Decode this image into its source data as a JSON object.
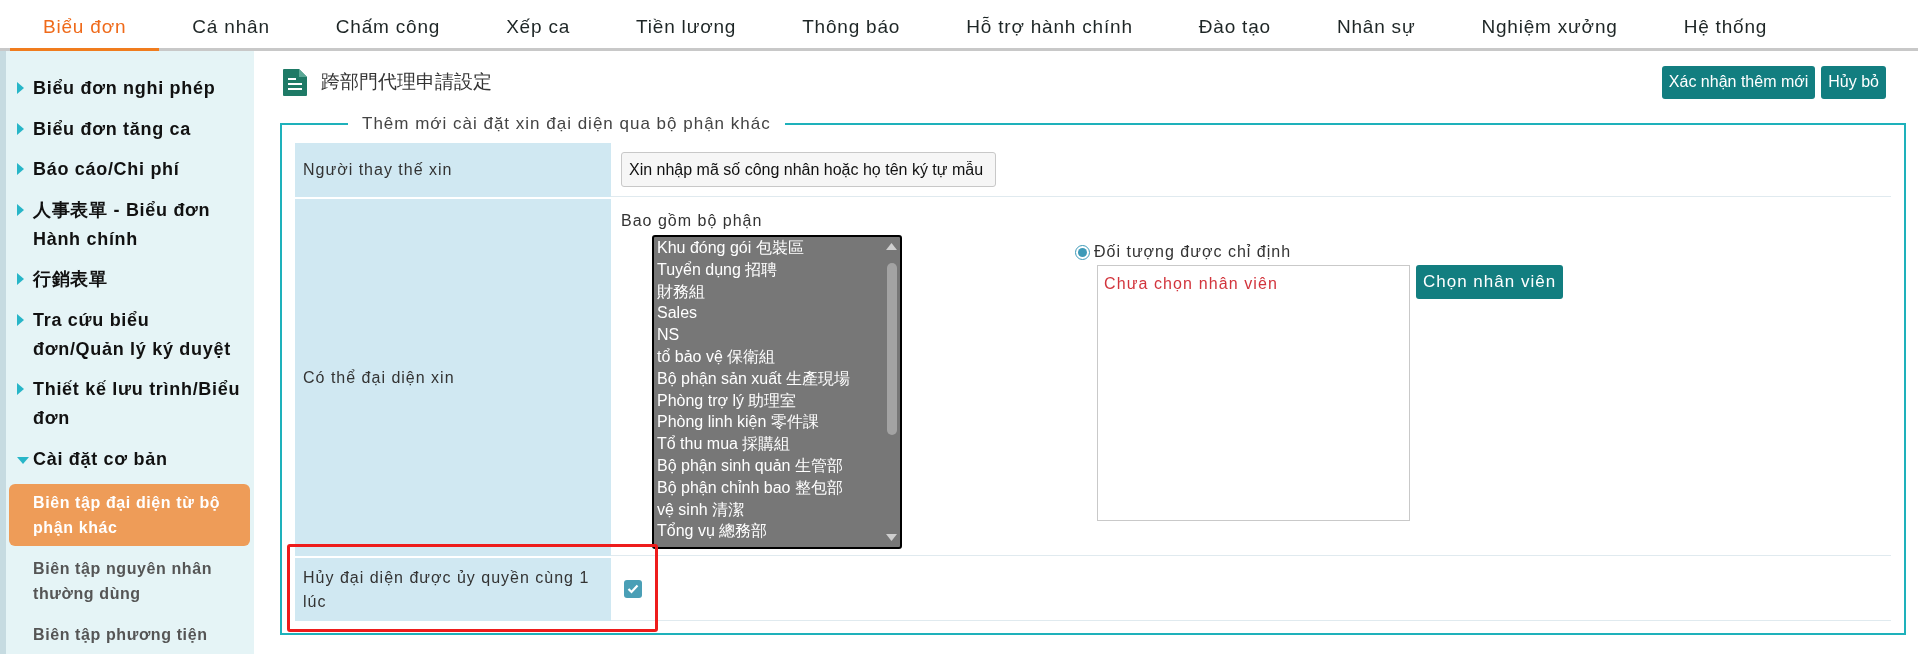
{
  "top_nav": {
    "tabs": [
      {
        "label": "Biểu đơn",
        "selected": true
      },
      {
        "label": "Cá nhân",
        "selected": false
      },
      {
        "label": "Chấm công",
        "selected": false
      },
      {
        "label": "Xếp ca",
        "selected": false
      },
      {
        "label": "Tiền lương",
        "selected": false
      },
      {
        "label": "Thông báo",
        "selected": false
      },
      {
        "label": "Hỗ trợ hành chính",
        "selected": false
      },
      {
        "label": "Đào tạo",
        "selected": false
      },
      {
        "label": "Nhân sự",
        "selected": false
      },
      {
        "label": "Nghiệm xưởng",
        "selected": false
      },
      {
        "label": "Hệ thống",
        "selected": false
      }
    ]
  },
  "sidebar": {
    "items": [
      {
        "label": "Biểu đơn nghi phép",
        "expanded": false
      },
      {
        "label": "Biểu đơn tăng ca",
        "expanded": false
      },
      {
        "label": "Báo cáo/Chi phí",
        "expanded": false
      },
      {
        "label": "人事表單 - Biểu đơn Hành chính",
        "expanded": false
      },
      {
        "label": "行銷表單",
        "expanded": false
      },
      {
        "label": "Tra cứu biểu đơn/Quản lý ký duyệt",
        "expanded": false
      },
      {
        "label": "Thiết kế lưu trình/Biểu đơn",
        "expanded": false
      },
      {
        "label": "Cài đặt cơ bản",
        "expanded": true,
        "children": [
          {
            "label": "Biên tập đại diện từ bộ phận khác",
            "selected": true
          },
          {
            "label": "Biên tập nguyên nhân thường dùng",
            "selected": false
          },
          {
            "label": "Biên tập phương tiện",
            "selected": false
          }
        ]
      }
    ]
  },
  "page": {
    "title": "跨部門代理申請設定",
    "buttons": [
      "Xác nhận thêm mới",
      "Hủy bỏ"
    ]
  },
  "form": {
    "legend": "Thêm mới cài đặt xin đại diện qua bộ phận khác",
    "rows": [
      {
        "kind": "text",
        "label": "Người thay thế xin",
        "placeholder": "Xin nhập mã số công nhân hoặc họ tên ký tự mẫu",
        "highlighted": false
      },
      {
        "kind": "scope",
        "label": "Có thể đại diện xin",
        "list_label": "Bao gồm bộ phận",
        "departments": [
          "Khu đóng gói 包裝區",
          "Tuyển dụng 招聘",
          "財務組",
          "Sales",
          "NS",
          "tổ bảo vệ 保衛組",
          "Bộ phận sản xuất 生產現場",
          "Phòng trợ lý 助理室",
          "Phòng linh kiện 零件課",
          "Tổ thu mua 採購組",
          "Bộ phận sinh quản 生管部",
          "Bộ phận chỉnh bao 整包部",
          "vệ sinh 清潔",
          "Tổng vụ 總務部"
        ],
        "option": {
          "label": "Đối tượng được chỉ định",
          "selected": true
        },
        "assignee_text": "Chưa chọn nhân viên",
        "button": "Chọn nhân viên",
        "highlighted": false
      },
      {
        "kind": "checkbox",
        "label": "Hủy đại diện được ủy quyền cùng 1 lúc",
        "checked": true,
        "highlighted": true
      }
    ]
  }
}
